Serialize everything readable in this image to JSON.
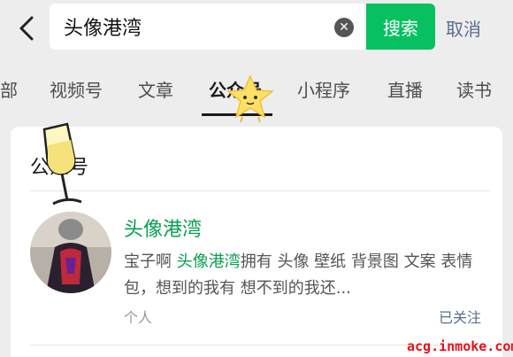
{
  "search": {
    "query": "头像港湾",
    "button_label": "搜索",
    "cancel_label": "取消"
  },
  "tabs": [
    {
      "label": "部"
    },
    {
      "label": "视频号"
    },
    {
      "label": "文章"
    },
    {
      "label": "公众号",
      "active": true
    },
    {
      "label": "小程序"
    },
    {
      "label": "直播"
    },
    {
      "label": "读书"
    }
  ],
  "card": {
    "section_title": "公众号",
    "result": {
      "title": "头像港湾",
      "desc_before": "宝子啊 ",
      "desc_highlight": "头像港湾",
      "desc_after": "拥有 头像 壁纸 背景图 文案 表情包，想到的我有 想不到的我还...",
      "type": "个人",
      "follow_status": "已关注"
    }
  },
  "watermark": "acg.inmoke.com",
  "colors": {
    "accent_green": "#07c160",
    "highlight_green": "#07a04f",
    "link_blue": "#5a6d8c",
    "watermark_red": "#e8121b"
  }
}
